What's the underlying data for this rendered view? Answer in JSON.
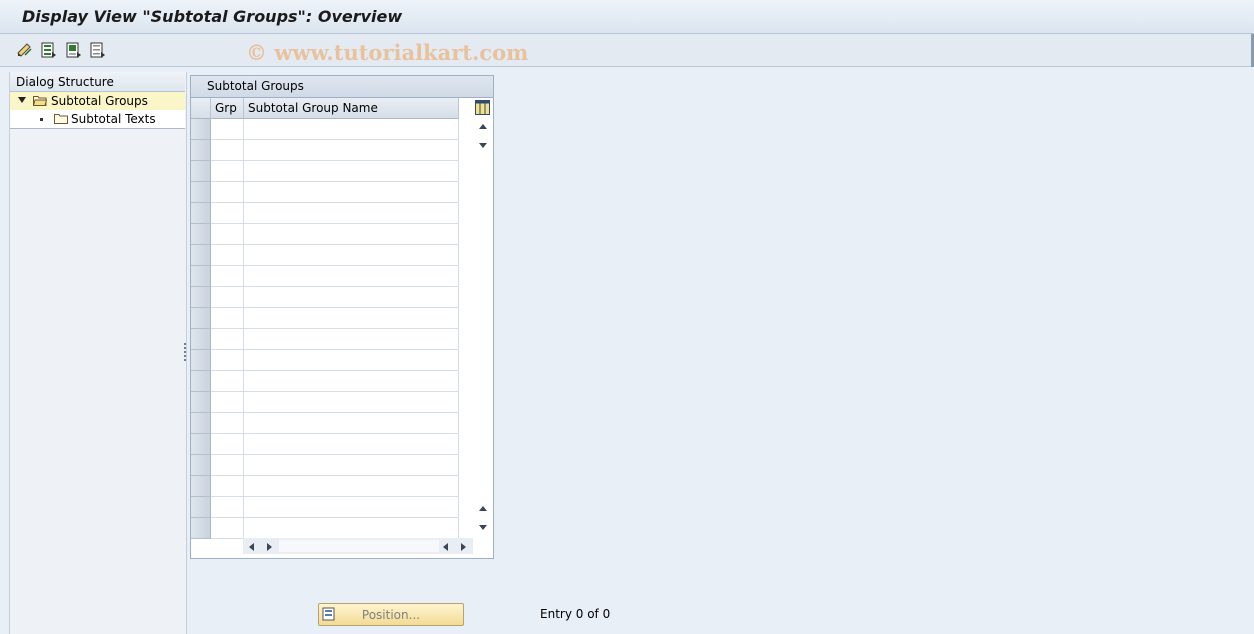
{
  "window": {
    "title": "Display View \"Subtotal Groups\": Overview"
  },
  "toolbar": {
    "buttons": [
      {
        "icon": "change-display-icon"
      },
      {
        "icon": "select-all-icon"
      },
      {
        "icon": "select-block-icon"
      },
      {
        "icon": "deselect-all-icon"
      }
    ],
    "watermark": "© www.tutorialkart.com"
  },
  "dialog_structure": {
    "header": "Dialog Structure",
    "nodes": [
      {
        "label": "Subtotal Groups",
        "expanded": true,
        "selected": true
      },
      {
        "label": "Subtotal Texts",
        "expanded": false,
        "selected": false
      }
    ]
  },
  "table": {
    "caption": "Subtotal Groups",
    "columns": [
      "Grp",
      "Subtotal Group Name"
    ],
    "rows": [],
    "visible_empty_rows": 20
  },
  "footer": {
    "position_button": "Position...",
    "entry_text": "Entry 0 of 0"
  },
  "colors": {
    "background": "#e9eff6",
    "selected_node": "#fbf6c8",
    "button_fill": "#f2db95"
  }
}
